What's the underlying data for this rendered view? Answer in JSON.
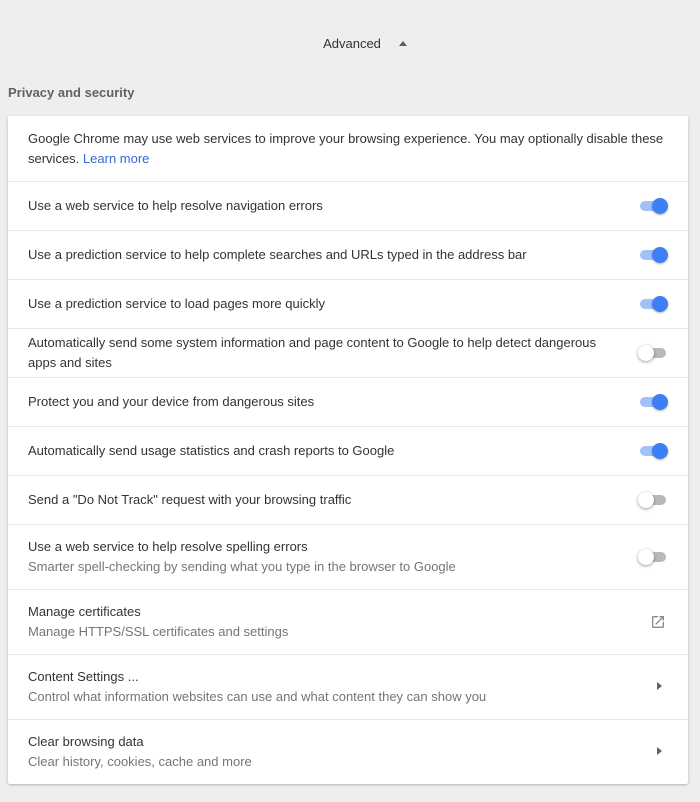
{
  "advanced": {
    "label": "Advanced",
    "icon": "arrow-up-icon"
  },
  "section_title": "Privacy and security",
  "intro": {
    "text": "Google Chrome may use web services to improve your browsing experience. You may optionally disable these services.",
    "link": "Learn more"
  },
  "settings": [
    {
      "label": "Use a web service to help resolve navigation errors",
      "enabled": true
    },
    {
      "label": "Use a prediction service to help complete searches and URLs typed in the address bar",
      "enabled": true
    },
    {
      "label": "Use a prediction service to load pages more quickly",
      "enabled": true
    },
    {
      "label": "Automatically send some system information and page content to Google to help detect dangerous apps and sites",
      "enabled": false
    },
    {
      "label": "Protect you and your device from dangerous sites",
      "enabled": true
    },
    {
      "label": "Automatically send usage statistics and crash reports to Google",
      "enabled": true
    },
    {
      "label": "Send a \"Do Not Track\" request with your browsing traffic",
      "enabled": false
    },
    {
      "label": "Use a web service to help resolve spelling errors",
      "sublabel": "Smarter spell-checking by sending what you type in the browser to Google",
      "enabled": false
    }
  ],
  "links": [
    {
      "label": "Manage certificates",
      "sublabel": "Manage HTTPS/SSL certificates and settings",
      "icon": "external-link-icon"
    },
    {
      "label": "Content Settings ...",
      "sublabel": "Control what information websites can use and what content they can show you",
      "icon": "chevron-right-icon"
    },
    {
      "label": "Clear browsing data",
      "sublabel": "Clear history, cookies, cache and more",
      "icon": "chevron-right-icon"
    }
  ],
  "colors": {
    "toggle_on_knob": "#3d80f6",
    "toggle_on_track": "#a1c1f7",
    "link": "#3367d6",
    "background": "#eeeeee"
  }
}
